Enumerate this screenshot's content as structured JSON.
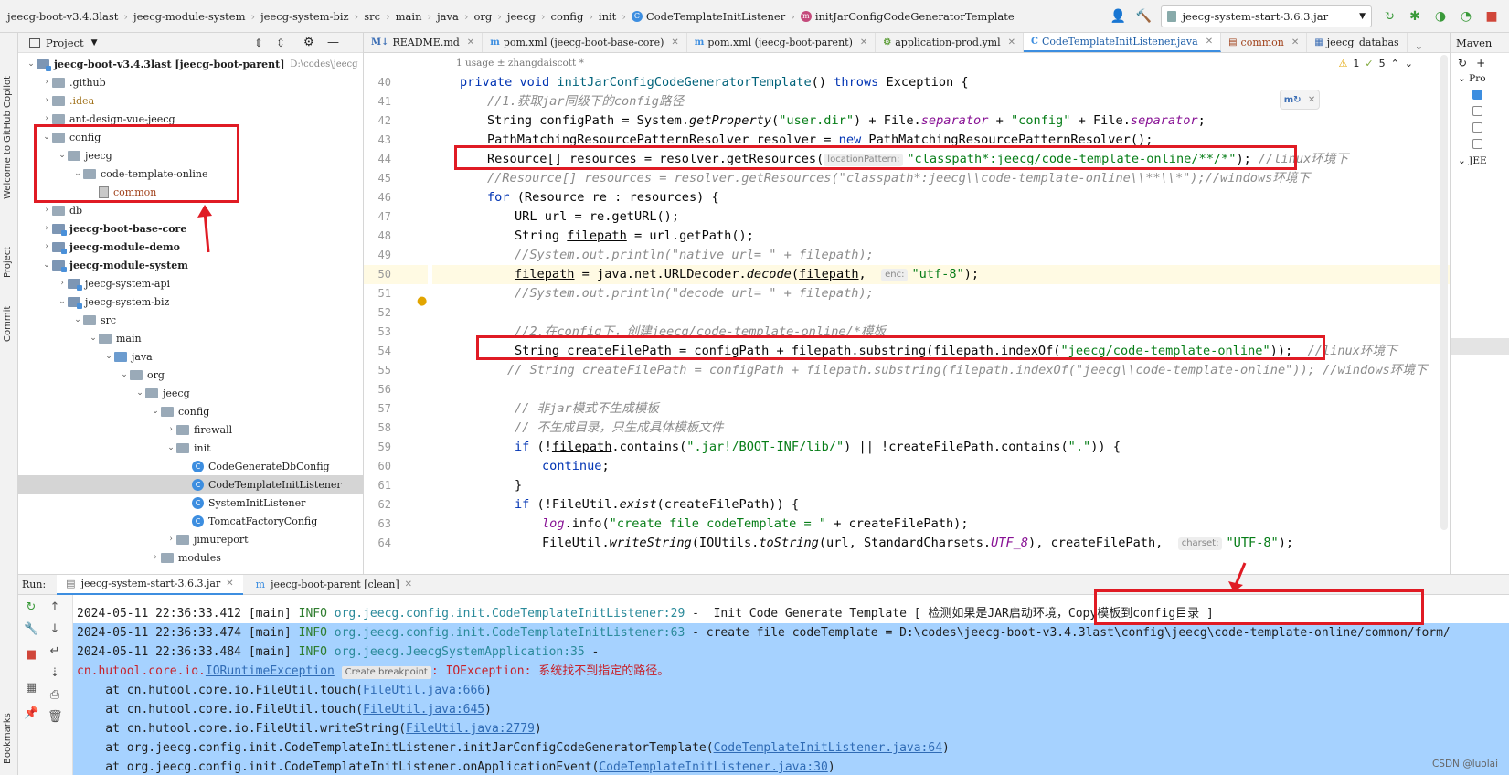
{
  "breadcrumbs": [
    "jeecg-boot-v3.4.3last",
    "jeecg-module-system",
    "jeecg-system-biz",
    "src",
    "main",
    "java",
    "org",
    "jeecg",
    "config",
    "init",
    "CodeTemplateInitListener",
    "initJarConfigCodeGeneratorTemplate"
  ],
  "toolbar": {
    "run_config": "jeecg-system-start-3.6.3.jar"
  },
  "sidebar_stripe": [
    "Welcome to GitHub Copilot",
    "Project",
    "Commit",
    "Bookmarks"
  ],
  "project": {
    "title": "Project",
    "tree": [
      {
        "label": "jeecg-boot-v3.4.3last [jeecg-boot-parent]",
        "suffix": "D:\\codes\\jeecg",
        "depth": 0,
        "icon": "module-folder-icon",
        "expanded": true
      },
      {
        "label": ".github",
        "depth": 1,
        "icon": "folder-icon",
        "expanded": false
      },
      {
        "label": ".idea",
        "depth": 1,
        "icon": "folder-icon",
        "expanded": false,
        "color": "#a0711a"
      },
      {
        "label": "ant-design-vue-jeecg",
        "depth": 1,
        "icon": "folder-icon",
        "expanded": false
      },
      {
        "label": "config",
        "depth": 1,
        "icon": "folder-icon",
        "expanded": true
      },
      {
        "label": "jeecg",
        "depth": 2,
        "icon": "folder-icon",
        "expanded": true
      },
      {
        "label": "code-template-online",
        "depth": 3,
        "icon": "folder-icon",
        "expanded": true
      },
      {
        "label": "common",
        "depth": 4,
        "icon": "file-icon",
        "leaf": true,
        "color": "#a0411a"
      },
      {
        "label": "db",
        "depth": 1,
        "icon": "folder-icon",
        "expanded": false
      },
      {
        "label": "jeecg-boot-base-core",
        "depth": 1,
        "icon": "module-folder-icon",
        "expanded": false
      },
      {
        "label": "jeecg-module-demo",
        "depth": 1,
        "icon": "module-folder-icon",
        "expanded": false
      },
      {
        "label": "jeecg-module-system",
        "depth": 1,
        "icon": "module-folder-icon",
        "expanded": true
      },
      {
        "label": "jeecg-system-api",
        "depth": 2,
        "icon": "module-folder-icon",
        "expanded": false
      },
      {
        "label": "jeecg-system-biz",
        "depth": 2,
        "icon": "module-folder-icon",
        "expanded": true
      },
      {
        "label": "src",
        "depth": 3,
        "icon": "folder-icon",
        "expanded": true
      },
      {
        "label": "main",
        "depth": 4,
        "icon": "folder-icon",
        "expanded": true
      },
      {
        "label": "java",
        "depth": 5,
        "icon": "source-folder-icon",
        "expanded": true
      },
      {
        "label": "org",
        "depth": 6,
        "icon": "folder-icon",
        "expanded": true
      },
      {
        "label": "jeecg",
        "depth": 7,
        "icon": "folder-icon",
        "expanded": true
      },
      {
        "label": "config",
        "depth": 8,
        "icon": "folder-icon",
        "expanded": true
      },
      {
        "label": "firewall",
        "depth": 9,
        "icon": "folder-icon",
        "expanded": false
      },
      {
        "label": "init",
        "depth": 9,
        "icon": "folder-icon",
        "expanded": true
      },
      {
        "label": "CodeGenerateDbConfig",
        "depth": 10,
        "icon": "class-icon",
        "leaf": true
      },
      {
        "label": "CodeTemplateInitListener",
        "depth": 10,
        "icon": "class-icon",
        "leaf": true,
        "selected": true
      },
      {
        "label": "SystemInitListener",
        "depth": 10,
        "icon": "class-icon",
        "leaf": true
      },
      {
        "label": "TomcatFactoryConfig",
        "depth": 10,
        "icon": "class-icon",
        "leaf": true
      },
      {
        "label": "jimureport",
        "depth": 9,
        "icon": "folder-icon",
        "expanded": false
      },
      {
        "label": "modules",
        "depth": 8,
        "icon": "folder-icon",
        "expanded": false
      }
    ]
  },
  "editor": {
    "tabs": [
      {
        "label": "README.md",
        "icon": "M↓",
        "color": "#3d6fb5"
      },
      {
        "label": "pom.xml (jeecg-boot-base-core)",
        "icon": "m",
        "color": "#3d8ee0"
      },
      {
        "label": "pom.xml (jeecg-boot-parent)",
        "icon": "m",
        "color": "#3d8ee0"
      },
      {
        "label": "application-prod.yml",
        "icon": "⚙",
        "color": "#5e9e3a"
      },
      {
        "label": "CodeTemplateInitListener.java",
        "icon": "C",
        "color": "#3d8ee0",
        "active": true
      },
      {
        "label": "common",
        "icon": "▤",
        "color": "#a0411a"
      },
      {
        "label": "jeecg_databas",
        "icon": "▦",
        "color": "#3d6fb5"
      }
    ],
    "usage_hint": "1 usage   ± zhangdaiscott *",
    "inspection": {
      "warnings": "1",
      "weak_warnings": "5"
    },
    "line_numbers": [
      "40",
      "41",
      "42",
      "43",
      "44",
      "45",
      "46",
      "47",
      "48",
      "49",
      "50",
      "51",
      "52",
      "53",
      "54",
      "55",
      "56",
      "57",
      "58",
      "59",
      "60",
      "61",
      "62",
      "63",
      "64"
    ]
  },
  "code": {
    "l40": {
      "a": "private void ",
      "b": "initJarConfigCodeGeneratorTemplate",
      "c": "() ",
      "d": "throws",
      "e": " Exception {"
    },
    "l41": "//1.获取jar同级下的config路径",
    "l42": {
      "a": "String configPath = System.",
      "b": "getProperty",
      "c": "(",
      "d": "\"user.dir\"",
      "e": ") + File.",
      "f": "separator",
      "g": " + ",
      "h": "\"config\"",
      "i": " + File.",
      "j": "separator",
      "k": ";"
    },
    "l43": {
      "a": "PathMatchingResourcePatternResolver resolver = ",
      "b": "new",
      "c": " PathMatchingResourcePatternResolver();"
    },
    "l44": {
      "a": "Resource[] resources = resolver.getResources(",
      "hint": "locationPattern:",
      "b": "\"classpath*:jeecg/code-template-online/**/*\"",
      "c": "); ",
      "d": "//linux环境下"
    },
    "l45": "//Resource[] resources = resolver.getResources(\"classpath*:jeecg\\\\code-template-online\\\\**\\\\*\");//windows环境下",
    "l46": {
      "a": "for",
      "b": " (Resource re : resources) {"
    },
    "l47": "URL url = re.getURL();",
    "l48": {
      "a": "String ",
      "b": "filepath",
      "c": " = url.getPath();"
    },
    "l49": "//System.out.println(\"native url= \" + filepath);",
    "l50": {
      "a": "filepath",
      "b": " = java.net.URLDecoder.",
      "c": "decode",
      "d": "(",
      "e": "filepath",
      "f": ",  ",
      "hint": "enc:",
      "g": "\"utf-8\"",
      "h": ");"
    },
    "l51": "//System.out.println(\"decode url= \" + filepath);",
    "l53": "//2.在config下，创建jeecg/code-template-online/*模板",
    "l54": {
      "a": "String createFilePath = configPath + ",
      "b": "filepath",
      "c": ".substring(",
      "d": "filepath",
      "e": ".indexOf(",
      "f": "\"jeecg/code-template-online\"",
      "g": "));  ",
      "h": "//linux环境下"
    },
    "l55": "// String createFilePath = configPath + filepath.substring(filepath.indexOf(\"jeecg\\\\code-template-online\")); //windows环境下",
    "l57": "// 非jar模式不生成模板",
    "l58": "// 不生成目录，只生成具体模板文件",
    "l59": {
      "a": "if",
      "b": " (!",
      "c": "filepath",
      "d": ".contains(",
      "e": "\".jar!/BOOT-INF/lib/\"",
      "f": ") || !createFilePath.contains(",
      "g": "\".\"",
      "h": ")) {"
    },
    "l60": {
      "a": "continue",
      "b": ";"
    },
    "l61": "}",
    "l62": {
      "a": "if",
      "b": " (!FileUtil.",
      "c": "exist",
      "d": "(createFilePath)) {"
    },
    "l63": {
      "a": "log",
      "b": ".info(",
      "c": "\"create file codeTemplate = \"",
      "d": " + createFilePath);"
    },
    "l64": {
      "a": "FileUtil.",
      "b": "writeString",
      "c": "(IOUtils.",
      "d": "toString",
      "e": "(url, StandardCharsets.",
      "f": "UTF_8",
      "g": "), createFilePath,  ",
      "hint": "charset:",
      "h": "\"UTF-8\"",
      "i": ");"
    }
  },
  "maven": {
    "title": "Maven",
    "items": [
      "Pro",
      "JEE"
    ]
  },
  "run": {
    "label": "Run:",
    "tabs": [
      {
        "label": "jeecg-system-start-3.6.3.jar",
        "active": true
      },
      {
        "label": "jeecg-boot-parent [clean]",
        "active": false
      }
    ],
    "logs": [
      {
        "ts": "2024-05-11 22:36:33.412",
        "thread": "[main]",
        "level": "INFO",
        "cls": "org.jeecg.config.init.CodeTemplateInitListener:29",
        "msg": " -  Init Code Generate Template [ 检测如果是JAR启动环境，Copy模板到config目录 ]"
      },
      {
        "ts": "2024-05-11 22:36:33.474",
        "thread": "[main]",
        "level": "INFO",
        "cls": "org.jeecg.config.init.CodeTemplateInitListener:63",
        "msg": " - create file codeTemplate = D:\\codes\\jeecg-boot-v3.4.3last\\",
        "tail": "config\\jeecg\\code-template-online/common/form/"
      },
      {
        "ts": "2024-05-11 22:36:33.484",
        "thread": "[main]",
        "level": "INFO",
        "cls": "org.jeecg.JeecgSystemApplication:35",
        "msg": " -"
      }
    ],
    "exception": {
      "pkg": "cn.hutool.core.io.",
      "name": "IORuntimeException",
      "bp": "Create breakpoint",
      "msg": ": IOException: 系统找不到指定的路径。"
    },
    "stack": [
      {
        "prefix": "    at cn.hutool.core.io.FileUtil.touch(",
        "link": "FileUtil.java:666",
        "suffix": ")"
      },
      {
        "prefix": "    at cn.hutool.core.io.FileUtil.touch(",
        "link": "FileUtil.java:645",
        "suffix": ")"
      },
      {
        "prefix": "    at cn.hutool.core.io.FileUtil.writeString(",
        "link": "FileUtil.java:2779",
        "suffix": ")"
      },
      {
        "prefix": "    at org.jeecg.config.init.CodeTemplateInitListener.initJarConfigCodeGeneratorTemplate(",
        "link": "CodeTemplateInitListener.java:64",
        "suffix": ")"
      },
      {
        "prefix": "    at org.jeecg.config.init.CodeTemplateInitListener.onApplicationEvent(",
        "link": "CodeTemplateInitListener.java:30",
        "suffix": ")"
      }
    ]
  },
  "watermark": "CSDN @luolai",
  "colors": {
    "accent": "#3d8ee0",
    "annotation_red": "#e01b24",
    "selection": "#a6d2ff"
  }
}
